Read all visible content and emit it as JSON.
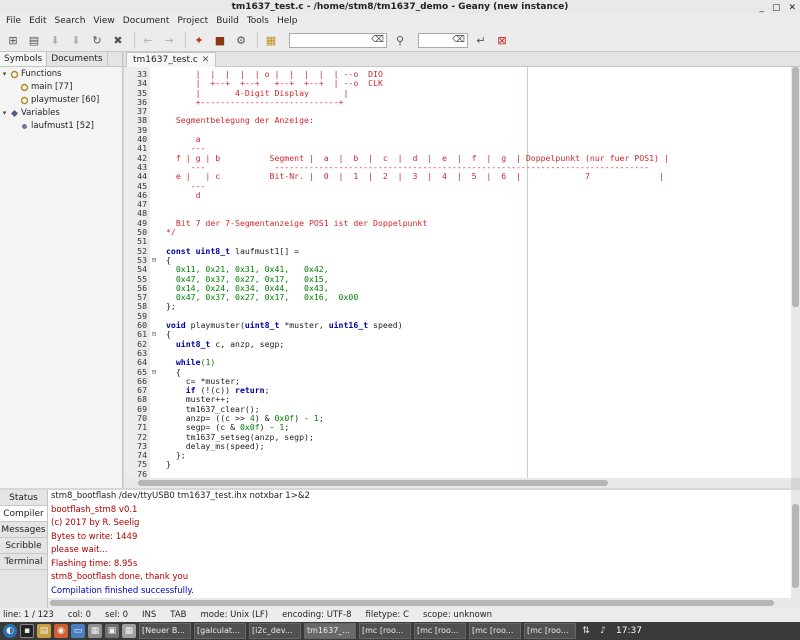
{
  "window": {
    "title": "tm1637_test.c - /home/stm8/tm1637_demo - Geany (new instance)",
    "controls": [
      "_",
      "▢",
      "✕"
    ]
  },
  "menu": [
    "File",
    "Edit",
    "Search",
    "View",
    "Document",
    "Project",
    "Build",
    "Tools",
    "Help"
  ],
  "toolbar": {
    "search_value": "",
    "goto_value": ""
  },
  "sidebar": {
    "tabs": [
      "Symbols",
      "Documents"
    ],
    "tree": [
      {
        "level": 0,
        "arrow": "▾",
        "label": "Functions"
      },
      {
        "level": 1,
        "arrow": "",
        "label": "main [77]"
      },
      {
        "level": 1,
        "arrow": "",
        "label": "playmuster [60]"
      },
      {
        "level": 0,
        "arrow": "▾",
        "label": "Variables"
      },
      {
        "level": 1,
        "arrow": "",
        "label": "laufmust1 [52]"
      }
    ]
  },
  "editor": {
    "tab_label": "tm1637_test.c",
    "tab_close": "✕"
  },
  "code": [
    {
      "n": "33",
      "f": "",
      "segs": [
        {
          "t": "      |  |  |  |  | o |  |  |  |  | --o  DIO",
          "c": "cm"
        }
      ]
    },
    {
      "n": "34",
      "f": "",
      "segs": [
        {
          "t": "      |  +--+  +--+   +--+  +--+  | --o  CLK",
          "c": "cm"
        }
      ]
    },
    {
      "n": "35",
      "f": "",
      "segs": [
        {
          "t": "      |       4-Digit Display       |",
          "c": "cm"
        }
      ]
    },
    {
      "n": "36",
      "f": "",
      "segs": [
        {
          "t": "      +----------------------------+",
          "c": "cm"
        }
      ]
    },
    {
      "n": "37",
      "f": "",
      "segs": [
        {
          "t": "",
          "c": "cm"
        }
      ]
    },
    {
      "n": "38",
      "f": "",
      "segs": [
        {
          "t": "  Segmentbelegung der Anzeige:",
          "c": "cm"
        }
      ]
    },
    {
      "n": "39",
      "f": "",
      "segs": [
        {
          "t": "",
          "c": "cm"
        }
      ]
    },
    {
      "n": "40",
      "f": "",
      "segs": [
        {
          "t": "      a",
          "c": "cm"
        }
      ]
    },
    {
      "n": "41",
      "f": "",
      "segs": [
        {
          "t": "     ---",
          "c": "cm"
        }
      ]
    },
    {
      "n": "42",
      "f": "",
      "segs": [
        {
          "t": "  f | g | b          Segment |  a  |  b  |  c  |  d  |  e  |  f  |  g  | Doppelpunkt (nur fuer POS1) |",
          "c": "cm"
        }
      ]
    },
    {
      "n": "43",
      "f": "",
      "segs": [
        {
          "t": "     ---              ----------------------------------------------------------------------------",
          "c": "cm"
        }
      ]
    },
    {
      "n": "44",
      "f": "",
      "segs": [
        {
          "t": "  e |   | c          Bit-Nr. |  0  |  1  |  2  |  3  |  4  |  5  |  6  |             7              |",
          "c": "cm"
        }
      ]
    },
    {
      "n": "45",
      "f": "",
      "segs": [
        {
          "t": "     ---",
          "c": "cm"
        }
      ]
    },
    {
      "n": "46",
      "f": "",
      "segs": [
        {
          "t": "      d",
          "c": "cm"
        }
      ]
    },
    {
      "n": "47",
      "f": "",
      "segs": [
        {
          "t": "",
          "c": "cm"
        }
      ]
    },
    {
      "n": "48",
      "f": "",
      "segs": [
        {
          "t": "",
          "c": "cm"
        }
      ]
    },
    {
      "n": "49",
      "f": "",
      "segs": [
        {
          "t": "  Bit 7 der 7-Segmentanzeige POS1 ist der Doppelpunkt",
          "c": "cm"
        }
      ]
    },
    {
      "n": "50",
      "f": "",
      "segs": [
        {
          "t": "*/",
          "c": "cm"
        }
      ]
    },
    {
      "n": "51",
      "f": "",
      "segs": [
        {
          "t": "",
          "c": ""
        }
      ]
    },
    {
      "n": "52",
      "f": "",
      "segs": [
        {
          "t": "const uint8_t",
          "c": "kw"
        },
        {
          "t": " laufmust1[] =",
          "c": ""
        }
      ]
    },
    {
      "n": "53",
      "f": "⊟",
      "segs": [
        {
          "t": "{",
          "c": ""
        }
      ]
    },
    {
      "n": "54",
      "f": "",
      "segs": [
        {
          "t": "  0x11, 0x21, 0x31, 0x41,   0x42,",
          "c": "num"
        }
      ]
    },
    {
      "n": "55",
      "f": "",
      "segs": [
        {
          "t": "  0x47, 0x37, 0x27, 0x17,   0x15,",
          "c": "num"
        }
      ]
    },
    {
      "n": "56",
      "f": "",
      "segs": [
        {
          "t": "  0x14, 0x24, 0x34, 0x44,   0x43,",
          "c": "num"
        }
      ]
    },
    {
      "n": "57",
      "f": "",
      "segs": [
        {
          "t": "  0x47, 0x37, 0x27, 0x17,   0x16,  0x00",
          "c": "num"
        }
      ]
    },
    {
      "n": "58",
      "f": "",
      "segs": [
        {
          "t": "};",
          "c": ""
        }
      ]
    },
    {
      "n": "59",
      "f": "",
      "segs": [
        {
          "t": "",
          "c": ""
        }
      ]
    },
    {
      "n": "60",
      "f": "",
      "segs": [
        {
          "t": "void",
          "c": "kw"
        },
        {
          "t": " playmuster(",
          "c": ""
        },
        {
          "t": "uint8_t",
          "c": "kw"
        },
        {
          "t": " *muster, ",
          "c": ""
        },
        {
          "t": "uint16_t",
          "c": "kw"
        },
        {
          "t": " speed)",
          "c": ""
        }
      ]
    },
    {
      "n": "61",
      "f": "⊟",
      "segs": [
        {
          "t": "{",
          "c": ""
        }
      ]
    },
    {
      "n": "62",
      "f": "",
      "segs": [
        {
          "t": "  ",
          "c": ""
        },
        {
          "t": "uint8_t",
          "c": "kw"
        },
        {
          "t": " c, anzp, segp;",
          "c": ""
        }
      ]
    },
    {
      "n": "63",
      "f": "",
      "segs": [
        {
          "t": "",
          "c": ""
        }
      ]
    },
    {
      "n": "64",
      "f": "",
      "segs": [
        {
          "t": "  ",
          "c": ""
        },
        {
          "t": "while",
          "c": "kw"
        },
        {
          "t": "(1)",
          "c": "num"
        }
      ]
    },
    {
      "n": "65",
      "f": "⊟",
      "segs": [
        {
          "t": "  {",
          "c": ""
        }
      ]
    },
    {
      "n": "66",
      "f": "",
      "segs": [
        {
          "t": "    c= *muster;",
          "c": ""
        }
      ]
    },
    {
      "n": "67",
      "f": "",
      "segs": [
        {
          "t": "    ",
          "c": ""
        },
        {
          "t": "if",
          "c": "kw"
        },
        {
          "t": " (!(c)) ",
          "c": ""
        },
        {
          "t": "return",
          "c": "kw"
        },
        {
          "t": ";",
          "c": ""
        }
      ]
    },
    {
      "n": "68",
      "f": "",
      "segs": [
        {
          "t": "    muster++;",
          "c": ""
        }
      ]
    },
    {
      "n": "69",
      "f": "",
      "segs": [
        {
          "t": "    tm1637_clear();",
          "c": ""
        }
      ]
    },
    {
      "n": "70",
      "f": "",
      "segs": [
        {
          "t": "    anzp= ((c >> ",
          "c": ""
        },
        {
          "t": "4",
          "c": "num"
        },
        {
          "t": ") & ",
          "c": ""
        },
        {
          "t": "0x0f",
          "c": "num"
        },
        {
          "t": ") - ",
          "c": ""
        },
        {
          "t": "1",
          "c": "num"
        },
        {
          "t": ";",
          "c": ""
        }
      ]
    },
    {
      "n": "71",
      "f": "",
      "segs": [
        {
          "t": "    segp= (c & ",
          "c": ""
        },
        {
          "t": "0x0f",
          "c": "num"
        },
        {
          "t": ") - ",
          "c": ""
        },
        {
          "t": "1",
          "c": "num"
        },
        {
          "t": ";",
          "c": ""
        }
      ]
    },
    {
      "n": "72",
      "f": "",
      "segs": [
        {
          "t": "    tm1637_setseg(anzp, segp);",
          "c": ""
        }
      ]
    },
    {
      "n": "73",
      "f": "",
      "segs": [
        {
          "t": "    delay_ms(speed);",
          "c": ""
        }
      ]
    },
    {
      "n": "74",
      "f": "",
      "segs": [
        {
          "t": "  };",
          "c": ""
        }
      ]
    },
    {
      "n": "75",
      "f": "",
      "segs": [
        {
          "t": "}",
          "c": ""
        }
      ]
    },
    {
      "n": "76",
      "f": "",
      "segs": [
        {
          "t": "",
          "c": ""
        }
      ]
    }
  ],
  "messages": {
    "tabs": [
      "Status",
      "Compiler",
      "Messages",
      "Scribble",
      "Terminal"
    ],
    "active_tab": "Compiler",
    "lines": [
      {
        "text": "stm8_bootflash /dev/ttyUSB0 tm1637_test.ihx notxbar 1>&2",
        "color": "#222222"
      },
      {
        "text": "bootflash_stm8 v0.1",
        "color": "#b00000"
      },
      {
        "text": "(c) 2017 by R. Seelig",
        "color": "#b00000"
      },
      {
        "text": "Bytes to write: 1449",
        "color": "#b00000"
      },
      {
        "text": "please wait...",
        "color": "#b00000"
      },
      {
        "text": "Flashing time: 8.95s",
        "color": "#b00000"
      },
      {
        "text": "stm8_bootflash done, thank you",
        "color": "#b00000"
      },
      {
        "text": "Compilation finished successfully.",
        "color": "#0000c8"
      }
    ]
  },
  "status": {
    "line": "line: 1 / 123",
    "col": "col: 0",
    "sel": "sel: 0",
    "ins": "INS",
    "tab": "TAB",
    "mode": "mode: Unix (LF)",
    "encoding": "encoding: UTF-8",
    "filetype": "filetype: C",
    "scope": "scope: unknown"
  },
  "taskbar": {
    "tasks": [
      "[Neuer B...",
      "[galculat...",
      "[i2c_dev...",
      "tm1637_...",
      "[mc [roo...",
      "[mc [roo...",
      "[mc [roo...",
      "[mc [roo..."
    ],
    "active_task_index": 3,
    "clock": "17:37"
  }
}
